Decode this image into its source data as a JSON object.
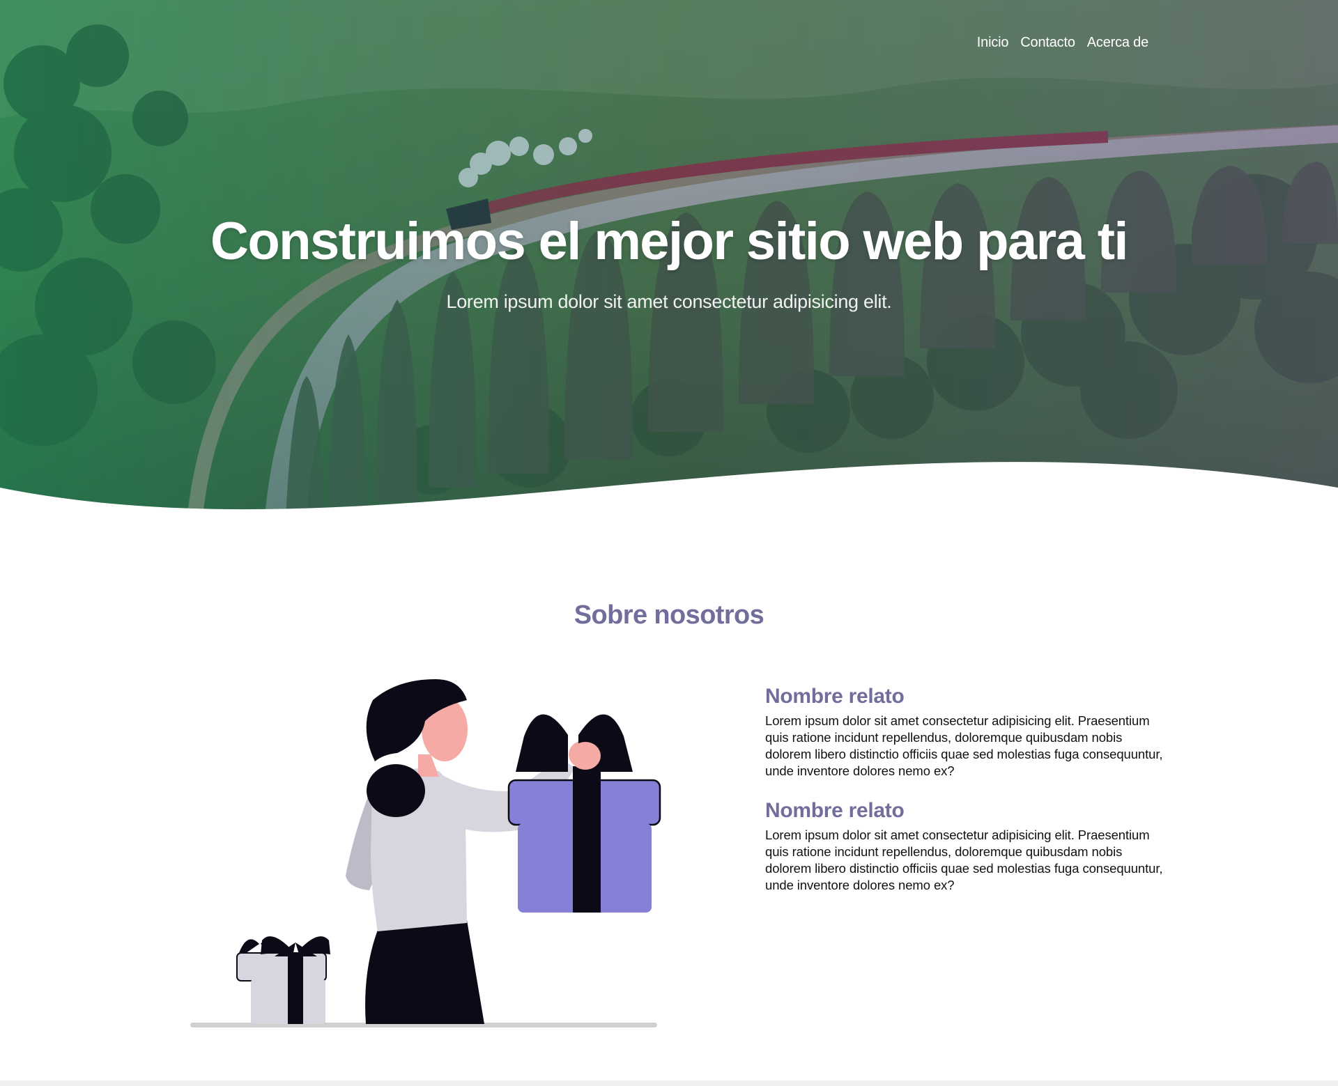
{
  "nav": {
    "items": [
      {
        "label": "Inicio"
      },
      {
        "label": "Contacto"
      },
      {
        "label": "Acerca de"
      }
    ]
  },
  "hero": {
    "title": "Construimos el mejor sitio web para ti",
    "subtitle": "Lorem ipsum dolor sit amet consectetur adipisicing elit."
  },
  "about": {
    "title": "Sobre nosotros",
    "stories": [
      {
        "title": "Nombre relato",
        "text": "Lorem ipsum dolor sit amet consectetur adipisicing elit. Praesentium quis ratione incidunt repellendus, doloremque quibusdam nobis dolorem libero distinctio officiis quae sed molestias fuga consequuntur, unde inventore dolores nemo ex?"
      },
      {
        "title": "Nombre relato",
        "text": "Lorem ipsum dolor sit amet consectetur adipisicing elit. Praesentium quis ratione incidunt repellendus, doloremque quibusdam nobis dolorem libero distinctio officiis quae sed molestias fuga consequuntur, unde inventore dolores nemo ex?"
      }
    ]
  },
  "colors": {
    "accent": "#726e9b",
    "gift": "#8681d6",
    "ink": "#0b0a16"
  }
}
